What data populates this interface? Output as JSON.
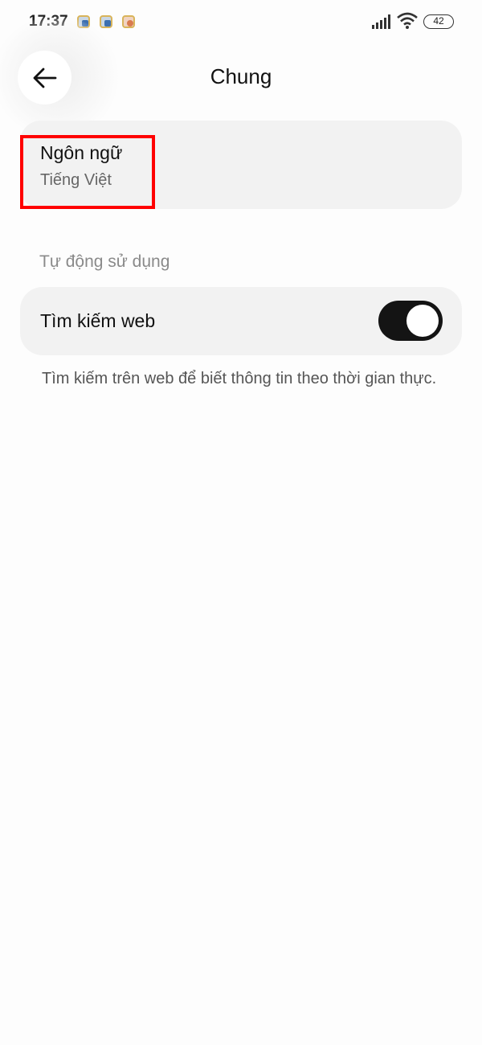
{
  "status_bar": {
    "time": "17:37",
    "battery": "42",
    "icons": [
      "app-notification-icon",
      "app-notification-icon",
      "app-notification-icon",
      "signal-icon",
      "wifi-icon",
      "battery-icon"
    ]
  },
  "header": {
    "title": "Chung",
    "back_icon": "back-arrow-icon"
  },
  "language": {
    "label": "Ngôn ngữ",
    "value": "Tiếng Việt"
  },
  "auto_use": {
    "section_label": "Tự động sử dụng",
    "web_search_label": "Tìm kiếm web",
    "web_search_enabled": true,
    "web_search_description": "Tìm kiếm trên web để biết thông tin theo thời gian thực."
  },
  "colors": {
    "highlight": "#ff0000",
    "toggle_on": "#141414",
    "card_bg": "#f2f2f2"
  }
}
